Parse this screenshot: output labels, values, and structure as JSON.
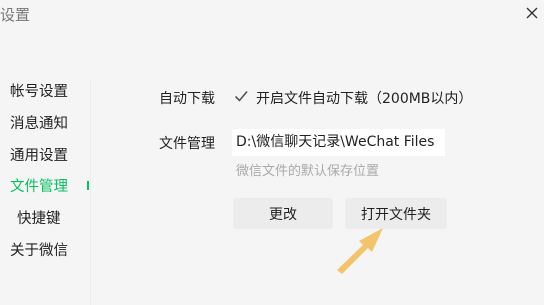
{
  "window": {
    "title": "设置"
  },
  "sidebar": {
    "items": [
      {
        "label": "帐号设置"
      },
      {
        "label": "消息通知"
      },
      {
        "label": "通用设置"
      },
      {
        "label": "文件管理"
      },
      {
        "label": "快捷键"
      },
      {
        "label": "关于微信"
      }
    ],
    "active": "文件管理"
  },
  "auto_download": {
    "label": "自动下载",
    "checkbox_label": "开启文件自动下载（200MB以内）",
    "checked": true
  },
  "file_management": {
    "label": "文件管理",
    "path": "D:\\微信聊天记录\\WeChat Files",
    "hint": "微信文件的默认保存位置",
    "change_button": "更改",
    "open_folder_button": "打开文件夹"
  },
  "colors": {
    "accent": "#07c160",
    "annotation_arrow": "#f2c46d",
    "background": "#f5f5f5",
    "button": "#ececec"
  },
  "icons": {
    "close": "close-icon",
    "checkmark": "checkmark-icon",
    "annotation": "arrow-pointer-icon"
  }
}
